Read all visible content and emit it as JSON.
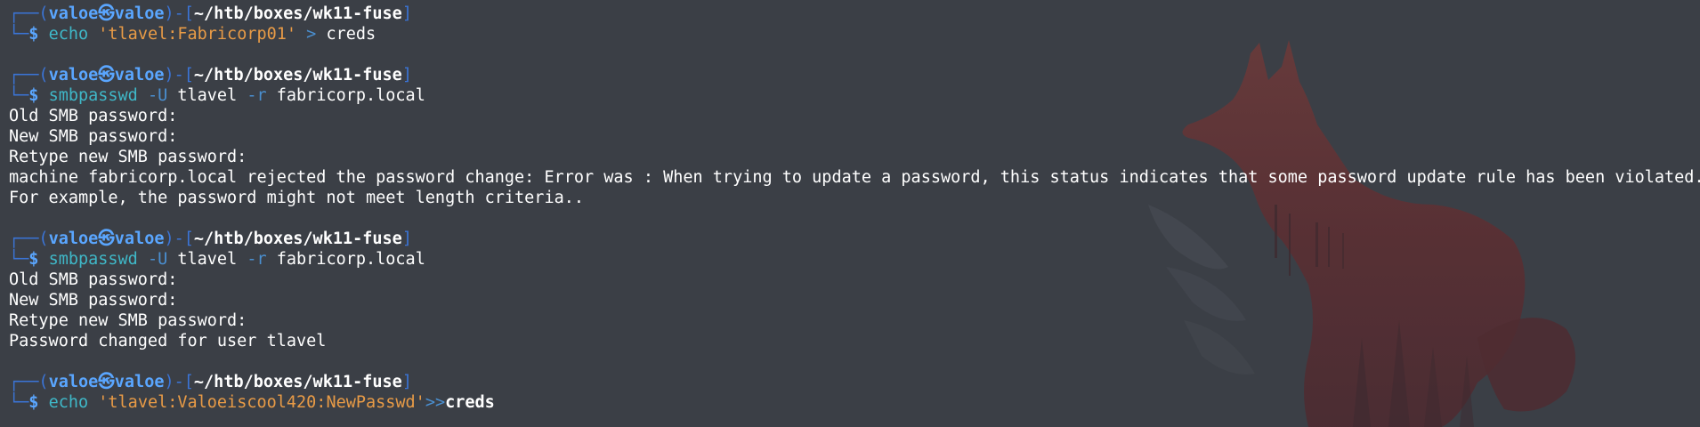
{
  "prompt": {
    "corner_top": "┌──(",
    "user": "valoe",
    "skull": "㉿",
    "host": "valoe",
    "mid": ")-[",
    "path": "~/htb/boxes/wk11-fuse",
    "end": "]",
    "corner_bottom": "└─",
    "dollar": "$"
  },
  "blocks": [
    {
      "command": {
        "cmd": "echo",
        "args": [
          {
            "type": "str",
            "text": "'tlavel:Fabricorp01'"
          },
          {
            "type": "redir",
            "text": ">"
          },
          {
            "type": "plain",
            "text": "creds"
          }
        ]
      },
      "output": []
    },
    {
      "command": {
        "cmd": "smbpasswd",
        "args": [
          {
            "type": "opt",
            "text": "-U"
          },
          {
            "type": "plain",
            "text": "tlavel"
          },
          {
            "type": "opt",
            "text": "-r"
          },
          {
            "type": "plain",
            "text": "fabricorp.local"
          }
        ]
      },
      "output": [
        "Old SMB password:",
        "New SMB password:",
        "Retype new SMB password:",
        "machine fabricorp.local rejected the password change: Error was : When trying to update a password, this status indicates that some password update rule has been violated.",
        "For example, the password might not meet length criteria.."
      ]
    },
    {
      "command": {
        "cmd": "smbpasswd",
        "args": [
          {
            "type": "opt",
            "text": "-U"
          },
          {
            "type": "plain",
            "text": "tlavel"
          },
          {
            "type": "opt",
            "text": "-r"
          },
          {
            "type": "plain",
            "text": "fabricorp.local"
          }
        ]
      },
      "output": [
        "Old SMB password:",
        "New SMB password:",
        "Retype new SMB password:",
        "Password changed for user tlavel"
      ]
    },
    {
      "command": {
        "cmd": "echo",
        "args": [
          {
            "type": "str",
            "text": "'tlavel:Valoeiscool420:NewPasswd'",
            "nospace": true
          },
          {
            "type": "redir",
            "text": ">>",
            "nospace": true
          },
          {
            "type": "boldplain",
            "text": "creds"
          }
        ]
      },
      "output": []
    }
  ],
  "colors": {
    "background": "#3b3f46",
    "bracket": "#3b74d6",
    "user": "#5aa6ff",
    "command": "#3fb8c8",
    "string": "#e89b46",
    "option": "#4a8fd0",
    "wallpaper_fox": "#5a3338"
  },
  "wallpaper": "fox-silhouette"
}
